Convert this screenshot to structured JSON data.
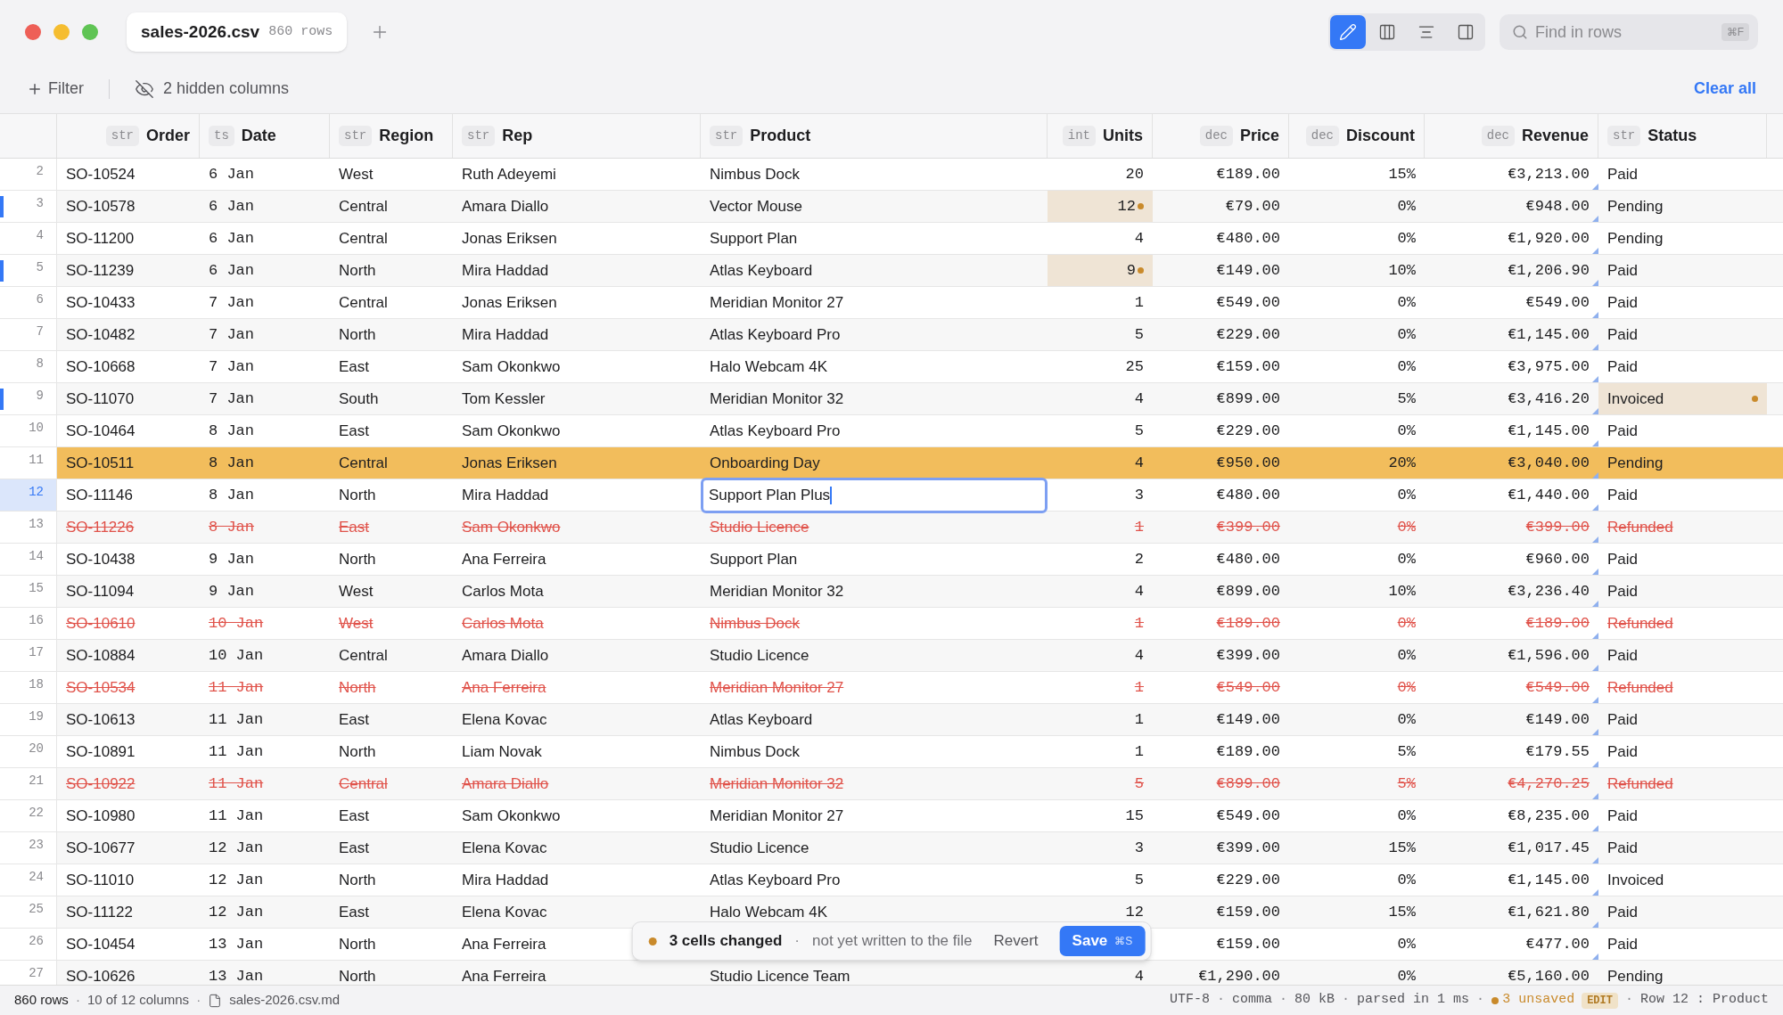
{
  "tab": {
    "title": "sales-2026.csv",
    "count": "860 rows"
  },
  "view_buttons": [
    {
      "kind": "edit",
      "selected": true
    },
    {
      "kind": "columns",
      "selected": false
    },
    {
      "kind": "lines",
      "selected": false
    },
    {
      "kind": "sidebar",
      "selected": false
    }
  ],
  "search": {
    "placeholder": "Find in rows",
    "shortcut": "⌘F"
  },
  "toolbar": {
    "filter": "Filter",
    "hidden_columns": "2 hidden columns",
    "clear": "Clear all"
  },
  "columns": [
    {
      "label": "Order",
      "type": "str"
    },
    {
      "label": "Date",
      "type": "ts"
    },
    {
      "label": "Region",
      "type": "str"
    },
    {
      "label": "Rep",
      "type": "str"
    },
    {
      "label": "Product",
      "type": "str"
    },
    {
      "label": "Units",
      "type": "int"
    },
    {
      "label": "Price",
      "type": "dec"
    },
    {
      "label": "Discount",
      "type": "dec"
    },
    {
      "label": "Revenue",
      "type": "dec",
      "computed": true
    },
    {
      "label": "Status",
      "type": "str"
    }
  ],
  "rows": [
    {
      "number": "2",
      "changed": false,
      "deleted": false,
      "selected": false,
      "current": false,
      "cells": [
        "SO-10524",
        "6 Jan",
        "West",
        "Ruth Adeyemi",
        "Nimbus Dock",
        "20",
        "€189.00",
        "15%",
        "€3,213.00",
        "Paid"
      ]
    },
    {
      "number": "3",
      "changed": true,
      "deleted": false,
      "selected": false,
      "current": false,
      "cells": [
        "SO-10578",
        "6 Jan",
        "Central",
        "Amara Diallo",
        "Vector Mouse",
        {
          "text": "12",
          "edited": true
        },
        "€79.00",
        "0%",
        "€948.00",
        "Pending"
      ]
    },
    {
      "number": "4",
      "changed": false,
      "deleted": false,
      "selected": false,
      "current": false,
      "cells": [
        "SO-11200",
        "6 Jan",
        "Central",
        "Jonas Eriksen",
        "Support Plan",
        "4",
        "€480.00",
        "0%",
        "€1,920.00",
        "Pending"
      ]
    },
    {
      "number": "5",
      "changed": true,
      "deleted": false,
      "selected": false,
      "current": false,
      "cells": [
        "SO-11239",
        "6 Jan",
        "North",
        "Mira Haddad",
        "Atlas Keyboard",
        {
          "text": "9",
          "edited": true
        },
        "€149.00",
        "10%",
        "€1,206.90",
        "Paid"
      ]
    },
    {
      "number": "6",
      "changed": false,
      "deleted": false,
      "selected": false,
      "current": false,
      "cells": [
        "SO-10433",
        "7 Jan",
        "Central",
        "Jonas Eriksen",
        "Meridian Monitor 27",
        "1",
        "€549.00",
        "0%",
        "€549.00",
        "Paid"
      ]
    },
    {
      "number": "7",
      "changed": false,
      "deleted": false,
      "selected": false,
      "current": false,
      "cells": [
        "SO-10482",
        "7 Jan",
        "North",
        "Mira Haddad",
        "Atlas Keyboard Pro",
        "5",
        "€229.00",
        "0%",
        "€1,145.00",
        "Paid"
      ]
    },
    {
      "number": "8",
      "changed": false,
      "deleted": false,
      "selected": false,
      "current": false,
      "cells": [
        "SO-10668",
        "7 Jan",
        "East",
        "Sam Okonkwo",
        "Halo Webcam 4K",
        "25",
        "€159.00",
        "0%",
        "€3,975.00",
        "Paid"
      ]
    },
    {
      "number": "9",
      "changed": true,
      "deleted": false,
      "selected": false,
      "current": false,
      "cells": [
        "SO-11070",
        "7 Jan",
        "South",
        "Tom Kessler",
        "Meridian Monitor 32",
        "4",
        "€899.00",
        "5%",
        "€3,416.20",
        {
          "text": "Invoiced",
          "edited": true
        }
      ]
    },
    {
      "number": "10",
      "changed": false,
      "deleted": false,
      "selected": false,
      "current": false,
      "cells": [
        "SO-10464",
        "8 Jan",
        "East",
        "Sam Okonkwo",
        "Atlas Keyboard Pro",
        "5",
        "€229.00",
        "0%",
        "€1,145.00",
        "Paid"
      ]
    },
    {
      "number": "11",
      "changed": false,
      "deleted": false,
      "selected": true,
      "current": false,
      "cells": [
        "SO-10511",
        "8 Jan",
        "Central",
        "Jonas Eriksen",
        "Onboarding Day",
        "4",
        "€950.00",
        "20%",
        "€3,040.00",
        "Pending"
      ]
    },
    {
      "number": "12",
      "changed": false,
      "deleted": false,
      "selected": false,
      "current": true,
      "cells": [
        "SO-11146",
        "8 Jan",
        "North",
        "Mira Haddad",
        {
          "text": "Support Plan Plus",
          "editing": true
        },
        "3",
        "€480.00",
        "0%",
        "€1,440.00",
        "Paid"
      ]
    },
    {
      "number": "13",
      "changed": false,
      "deleted": true,
      "selected": false,
      "current": false,
      "cells": [
        "SO-11226",
        "8 Jan",
        "East",
        "Sam Okonkwo",
        "Studio Licence",
        "1",
        "€399.00",
        "0%",
        "€399.00",
        "Refunded"
      ]
    },
    {
      "number": "14",
      "changed": false,
      "deleted": false,
      "selected": false,
      "current": false,
      "cells": [
        "SO-10438",
        "9 Jan",
        "North",
        "Ana Ferreira",
        "Support Plan",
        "2",
        "€480.00",
        "0%",
        "€960.00",
        "Paid"
      ]
    },
    {
      "number": "15",
      "changed": false,
      "deleted": false,
      "selected": false,
      "current": false,
      "cells": [
        "SO-11094",
        "9 Jan",
        "West",
        "Carlos Mota",
        "Meridian Monitor 32",
        "4",
        "€899.00",
        "10%",
        "€3,236.40",
        "Paid"
      ]
    },
    {
      "number": "16",
      "changed": false,
      "deleted": true,
      "selected": false,
      "current": false,
      "cells": [
        "SO-10610",
        "10 Jan",
        "West",
        "Carlos Mota",
        "Nimbus Dock",
        "1",
        "€189.00",
        "0%",
        "€189.00",
        "Refunded"
      ]
    },
    {
      "number": "17",
      "changed": false,
      "deleted": false,
      "selected": false,
      "current": false,
      "cells": [
        "SO-10884",
        "10 Jan",
        "Central",
        "Amara Diallo",
        "Studio Licence",
        "4",
        "€399.00",
        "0%",
        "€1,596.00",
        "Paid"
      ]
    },
    {
      "number": "18",
      "changed": false,
      "deleted": true,
      "selected": false,
      "current": false,
      "cells": [
        "SO-10534",
        "11 Jan",
        "North",
        "Ana Ferreira",
        "Meridian Monitor 27",
        "1",
        "€549.00",
        "0%",
        "€549.00",
        "Refunded"
      ]
    },
    {
      "number": "19",
      "changed": false,
      "deleted": false,
      "selected": false,
      "current": false,
      "cells": [
        "SO-10613",
        "11 Jan",
        "East",
        "Elena Kovac",
        "Atlas Keyboard",
        "1",
        "€149.00",
        "0%",
        "€149.00",
        "Paid"
      ]
    },
    {
      "number": "20",
      "changed": false,
      "deleted": false,
      "selected": false,
      "current": false,
      "cells": [
        "SO-10891",
        "11 Jan",
        "North",
        "Liam Novak",
        "Nimbus Dock",
        "1",
        "€189.00",
        "5%",
        "€179.55",
        "Paid"
      ]
    },
    {
      "number": "21",
      "changed": false,
      "deleted": true,
      "selected": false,
      "current": false,
      "cells": [
        "SO-10922",
        "11 Jan",
        "Central",
        "Amara Diallo",
        "Meridian Monitor 32",
        "5",
        "€899.00",
        "5%",
        "€4,270.25",
        "Refunded"
      ]
    },
    {
      "number": "22",
      "changed": false,
      "deleted": false,
      "selected": false,
      "current": false,
      "cells": [
        "SO-10980",
        "11 Jan",
        "East",
        "Sam Okonkwo",
        "Meridian Monitor 27",
        "15",
        "€549.00",
        "0%",
        "€8,235.00",
        "Paid"
      ]
    },
    {
      "number": "23",
      "changed": false,
      "deleted": false,
      "selected": false,
      "current": false,
      "cells": [
        "SO-10677",
        "12 Jan",
        "East",
        "Elena Kovac",
        "Studio Licence",
        "3",
        "€399.00",
        "15%",
        "€1,017.45",
        "Paid"
      ]
    },
    {
      "number": "24",
      "changed": false,
      "deleted": false,
      "selected": false,
      "current": false,
      "cells": [
        "SO-11010",
        "12 Jan",
        "North",
        "Mira Haddad",
        "Atlas Keyboard Pro",
        "5",
        "€229.00",
        "0%",
        "€1,145.00",
        "Invoiced"
      ]
    },
    {
      "number": "25",
      "changed": false,
      "deleted": false,
      "selected": false,
      "current": false,
      "cells": [
        "SO-11122",
        "12 Jan",
        "East",
        "Elena Kovac",
        "Halo Webcam 4K",
        "12",
        "€159.00",
        "15%",
        "€1,621.80",
        "Paid"
      ]
    },
    {
      "number": "26",
      "changed": false,
      "deleted": false,
      "selected": false,
      "current": false,
      "cells": [
        "SO-10454",
        "13 Jan",
        "North",
        "Ana Ferreira",
        null,
        null,
        "€159.00",
        "0%",
        "€477.00",
        "Paid"
      ]
    },
    {
      "number": "27",
      "changed": false,
      "deleted": false,
      "selected": false,
      "current": false,
      "cells": [
        "SO-10626",
        "13 Jan",
        "North",
        "Ana Ferreira",
        "Studio Licence Team",
        "4",
        "€1,290.00",
        "0%",
        "€5,160.00",
        "Pending"
      ]
    }
  ],
  "toast": {
    "message": "3 cells changed",
    "separator": "·",
    "detail": "not yet written to the file",
    "revert": "Revert",
    "save": "Save",
    "save_shortcut": "⌘S"
  },
  "status_bar": {
    "left": [
      {
        "kind": "text",
        "text": "860 rows"
      },
      {
        "kind": "sep",
        "text": "·"
      },
      {
        "kind": "text",
        "text": "10 of 12 columns"
      },
      {
        "kind": "sep",
        "text": "·"
      },
      {
        "kind": "file",
        "text": "sales-2026.csv.md"
      }
    ],
    "right": [
      {
        "kind": "mono",
        "text": "UTF-8"
      },
      {
        "kind": "sep",
        "text": "·"
      },
      {
        "kind": "mono",
        "text": "comma"
      },
      {
        "kind": "sep",
        "text": "·"
      },
      {
        "kind": "mono",
        "text": "80 kB"
      },
      {
        "kind": "sep",
        "text": "·"
      },
      {
        "kind": "mono",
        "text": "parsed in 1 ms"
      },
      {
        "kind": "sep",
        "text": "·"
      },
      {
        "kind": "unsaved",
        "text": "3 unsaved"
      },
      {
        "kind": "badge",
        "text": "EDIT"
      },
      {
        "kind": "sep",
        "text": "·"
      },
      {
        "kind": "mono",
        "text": "Row 12 : Product"
      }
    ]
  }
}
